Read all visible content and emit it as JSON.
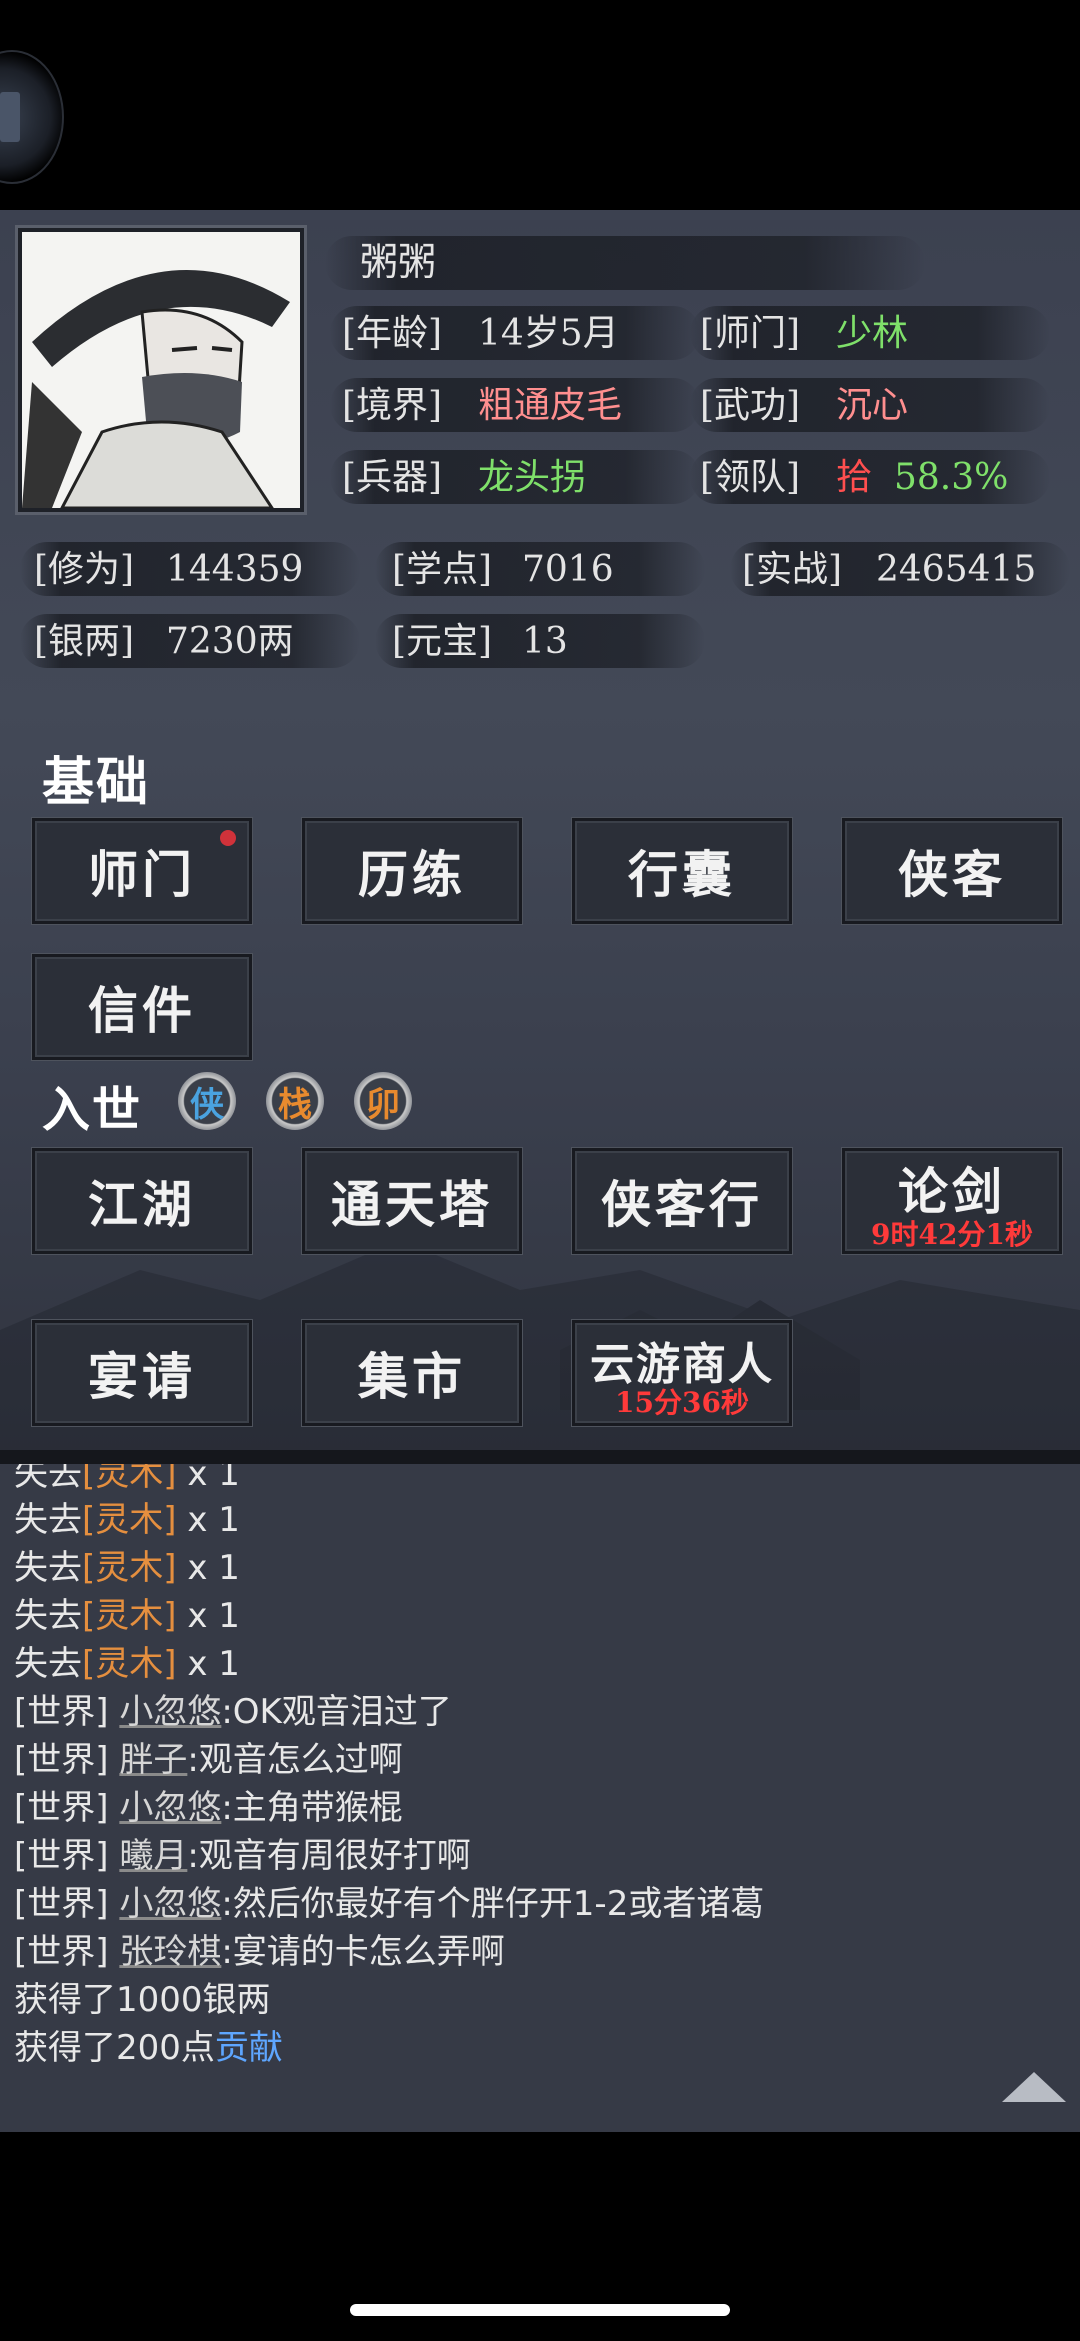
{
  "character": {
    "name": "粥粥",
    "age_label": "[年龄]",
    "age_value": "14岁5月",
    "sect_label": "[师门]",
    "sect_value": "少林",
    "realm_label": "[境界]",
    "realm_value": "粗通皮毛",
    "martial_label": "[武功]",
    "martial_value": "沉心",
    "weapon_label": "[兵器]",
    "weapon_value": "龙头拐",
    "team_label": "[领队]",
    "team_value": "拾",
    "team_percent": "58.3%"
  },
  "stats": {
    "cultivation_label": "[修为]",
    "cultivation_value": "144359",
    "study_label": "[学点]",
    "study_value": "7016",
    "combat_label": "[实战]",
    "combat_value": "2465415",
    "silver_label": "[银两]",
    "silver_value": "7230两",
    "ingot_label": "[元宝]",
    "ingot_value": "13"
  },
  "basics": {
    "title": "基础",
    "buttons": [
      "师门",
      "历练",
      "行囊",
      "侠客",
      "信件"
    ]
  },
  "world": {
    "title": "入世",
    "badges": [
      "侠",
      "栈",
      "卯"
    ],
    "buttons": [
      "江湖",
      "通天塔",
      "侠客行",
      "论剑",
      "宴请",
      "集市",
      "云游商人"
    ],
    "lunjian_timer": "9时42分1秒",
    "merchant_timer": "15分36秒"
  },
  "chat": {
    "lost_prefix": "失去",
    "lost_item": "[灵木]",
    "lost_count": " x 1",
    "world_tag": "[世界]",
    "messages": [
      {
        "name": "小忽悠",
        "text": ":OK观音泪过了"
      },
      {
        "name": "胖子",
        "text": ":观音怎么过啊"
      },
      {
        "name": "小忽悠",
        "text": ":主角带猴棍"
      },
      {
        "name": "曦月",
        "text": ":观音有周很好打啊"
      },
      {
        "name": "小忽悠",
        "text": ":然后你最好有个胖仔开1-2或者诸葛"
      },
      {
        "name": "张玲棋",
        "text": ":宴请的卡怎么弄啊"
      }
    ],
    "gain_silver": "获得了1000银两",
    "gain_contrib_prefix": "获得了200点",
    "gain_contrib_link": "贡献"
  }
}
